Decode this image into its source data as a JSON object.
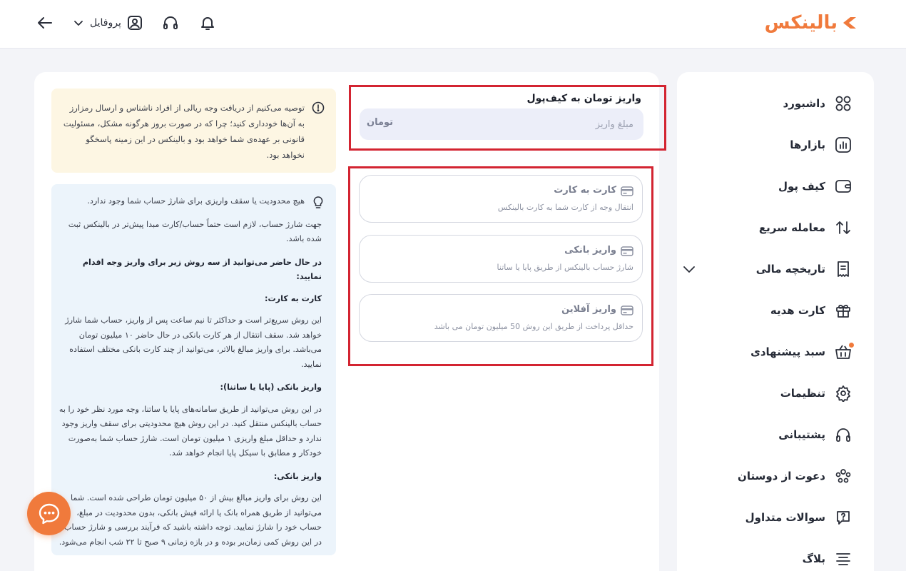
{
  "brand": {
    "logo_text": "بالینکس",
    "accent": "#f07a3c"
  },
  "header": {
    "profile_label": "پروفایل"
  },
  "sidebar": {
    "items": [
      {
        "label": "داشبورد",
        "icon": "grid-icon"
      },
      {
        "label": "بازارها",
        "icon": "chart-bars-icon"
      },
      {
        "label": "کیف پول",
        "icon": "wallet-icon"
      },
      {
        "label": "معامله سریع",
        "icon": "swap-arrows-icon"
      },
      {
        "label": "تاریخچه مالی",
        "icon": "receipt-icon"
      },
      {
        "label": "کارت هدیه",
        "icon": "gift-icon"
      },
      {
        "label": "سبد پیشنهادی",
        "icon": "basket-icon"
      },
      {
        "label": "تنظیمات",
        "icon": "gear-icon"
      },
      {
        "label": "پشتیبانی",
        "icon": "headphones-icon"
      },
      {
        "label": "دعوت از دوستان",
        "icon": "users-icon"
      },
      {
        "label": "سوالات متداول",
        "icon": "question-icon"
      },
      {
        "label": "بلاگ",
        "icon": "menu-lines-icon"
      }
    ]
  },
  "deposit": {
    "title": "واریز تومان به کیف‌پول",
    "amount_placeholder": "مبلغ واریز",
    "currency": "تومان"
  },
  "methods": [
    {
      "title": "کارت به کارت",
      "desc": "انتقال وجه از کارت شما به کارت بالینکس"
    },
    {
      "title": "واریز بانکی",
      "desc": "شارژ حساب بالینکس از طریق پایا یا ساتنا"
    },
    {
      "title": "واریز آفلاین",
      "desc": "حداقل پرداخت از طریق این روش 50 میلیون تومان می باشد"
    }
  ],
  "warning": {
    "text": "توصیه می‌کنیم از دریافت وجه ریالی از افراد ناشناس و ارسال رمزارز به آن‌ها خودداری کنید؛ چرا که در صورت بروز هرگونه مشکل، مسئولیت قانونی بر عهده‌ی شما خواهد بود و بالینکس در این زمینه پاسخگو نخواهد بود."
  },
  "info": {
    "p1": "هیچ محدودیت یا سقف واریزی برای شارژ حساب شما وجود ندارد.",
    "p2": "جهت شارژ حساب، لازم است حتماً حساب/کارت مبدا پیش‌تر در بالینکس ثبت شده باشد.",
    "intro": "در حال حاضر می‌توانید از سه روش زیر برای واریز وجه اقدام نمایید:",
    "sections": [
      {
        "heading": "کارت به کارت:",
        "body": "این روش سریع‌تر است و حداکثر تا نیم ساعت پس از واریز، حساب شما شارژ خواهد شد. سقف انتقال از هر کارت بانکی در حال حاضر ۱۰ میلیون تومان می‌باشد. برای واریز مبالغ بالاتر، می‌توانید از چند کارت بانکی مختلف استفاده نمایید."
      },
      {
        "heading": "واریز بانکی (پایا یا ساتنا):",
        "body": "در این روش می‌توانید از طریق سامانه‌های پایا یا ساتنا، وجه مورد نظر خود را به حساب بالینکس منتقل کنید. در این روش هیچ محدودیتی برای سقف واریز وجود ندارد و حداقل مبلغ واریزی ۱ میلیون تومان است. شارژ حساب شما به‌صورت خودکار و مطابق با سیکل پایا انجام خواهد شد."
      },
      {
        "heading": "واریز بانکی:",
        "body": "این روش برای واریز مبالغ بیش از ۵۰ میلیون تومان طراحی شده است. شما می‌توانید از طریق همراه بانک یا ارائه فیش بانکی، بدون محدودیت در مبلغ، حساب خود را شارژ نمایید. توجه داشته باشید که فرآیند بررسی و شارژ حساب در این روش کمی زمان‌بر بوده و در بازه زمانی ۹ صبح تا ۲۲ شب انجام می‌شود."
      }
    ]
  }
}
